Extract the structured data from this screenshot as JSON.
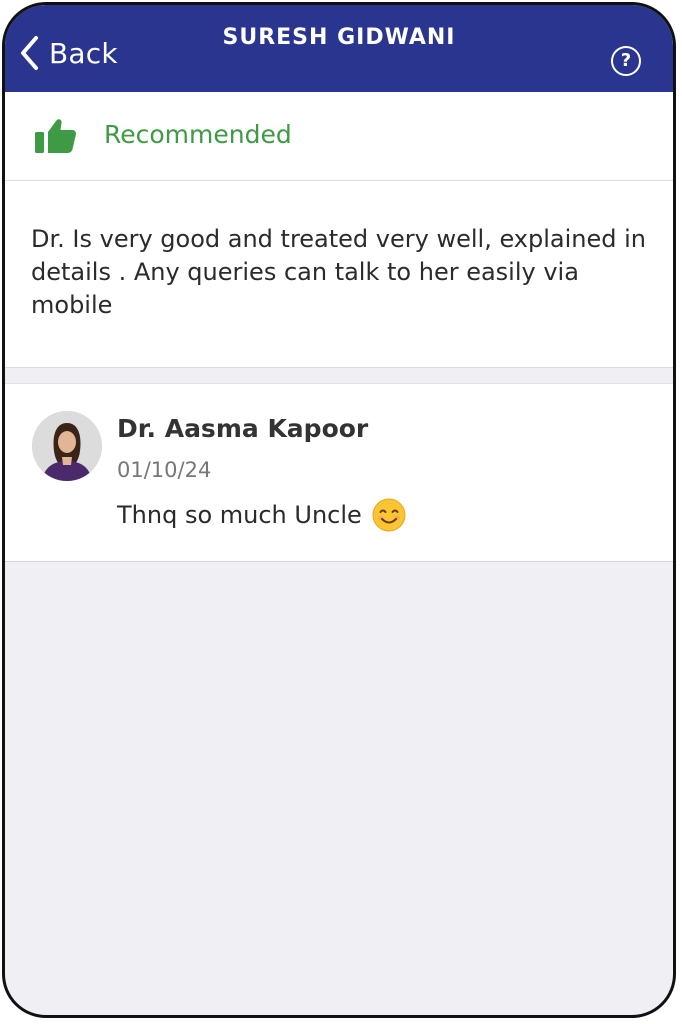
{
  "navbar": {
    "back_label": "Back",
    "title": "SURESH GIDWANI",
    "help_symbol": "?",
    "background": "#2a3590",
    "icons": [
      "chevron-left-icon",
      "help-circle-icon"
    ]
  },
  "recommendation": {
    "label": "Recommended",
    "icon": "thumbs-up-icon",
    "color": "#3e9a44"
  },
  "review": {
    "text": "Dr. Is very good and treated very well, explained in details . Any queries can talk to her easily via mobile"
  },
  "reply": {
    "author": "Dr. Aasma Kapoor",
    "date": "01/10/24",
    "text": "Thnq so much Uncle",
    "emoji": "smiling-face-emoji"
  }
}
